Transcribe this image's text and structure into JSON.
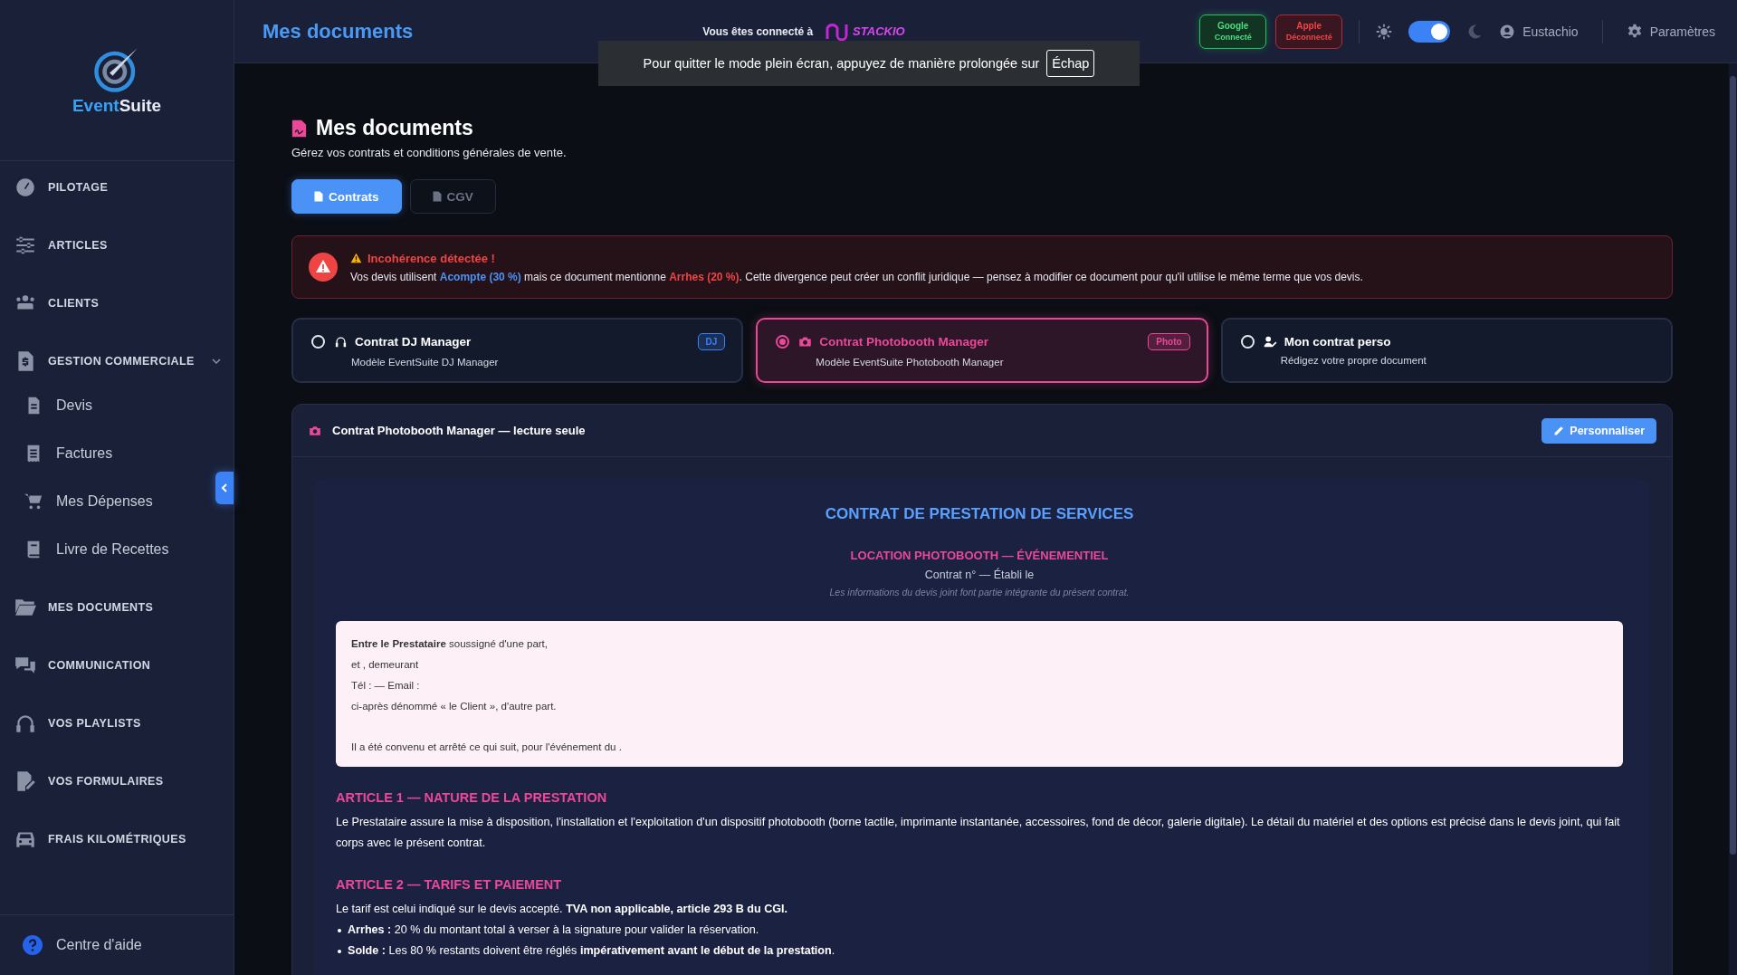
{
  "brand": {
    "first": "Event",
    "second": "Suite"
  },
  "sidebar": {
    "items": [
      {
        "label": "PILOTAGE"
      },
      {
        "label": "ARTICLES"
      },
      {
        "label": "CLIENTS"
      },
      {
        "label": "GESTION COMMERCIALE",
        "expanded": true,
        "children": [
          {
            "label": "Devis"
          },
          {
            "label": "Factures"
          },
          {
            "label": "Mes Dépenses"
          },
          {
            "label": "Livre de Recettes"
          }
        ]
      },
      {
        "label": "MES DOCUMENTS"
      },
      {
        "label": "COMMUNICATION"
      },
      {
        "label": "VOS PLAYLISTS"
      },
      {
        "label": "VOS FORMULAIRES"
      },
      {
        "label": "FRAIS KILOMÉTRIQUES"
      }
    ],
    "help": "Centre d'aide"
  },
  "header": {
    "title": "Mes documents",
    "connection_label": "Vous êtes connecté à",
    "partner_logo": "STACKIO",
    "services": [
      {
        "name": "Google",
        "status": "Connecté",
        "connected": true
      },
      {
        "name": "Apple",
        "status": "Déconnecté",
        "connected": false
      }
    ],
    "theme_toggle": {
      "on": true
    },
    "user": "Eustachio",
    "settings": "Paramètres"
  },
  "fullscreen_notice": {
    "text": "Pour quitter le mode plein écran, appuyez de manière prolongée sur",
    "key": "Échap"
  },
  "page": {
    "title": "Mes documents",
    "subtitle": "Gérez vos contrats et conditions générales de vente.",
    "tabs": [
      {
        "label": "Contrats",
        "selected": true
      },
      {
        "label": "CGV",
        "selected": false
      }
    ]
  },
  "alert": {
    "title": "Incohérence détectée !",
    "message": [
      {
        "text": "Vos devis utilisent ",
        "kind": "plain"
      },
      {
        "text": "Acompte (30 %)",
        "kind": "quote"
      },
      {
        "text": " mais ce document mentionne ",
        "kind": "plain"
      },
      {
        "text": "Arrhes (20 %)",
        "kind": "document"
      },
      {
        "text": ". Cette divergence peut créer un conflit juridique — pensez à modifier ce document pour qu'il utilise le même terme que vos devis.",
        "kind": "plain"
      }
    ]
  },
  "templates": [
    {
      "title": "Contrat DJ Manager",
      "subtitle": "Modèle EventSuite DJ Manager",
      "badge": "DJ",
      "color": "#3b82f6",
      "selected": false
    },
    {
      "title": "Contrat Photobooth Manager",
      "subtitle": "Modèle EventSuite Photobooth Manager",
      "badge": "Photo",
      "color": "#ec4899",
      "selected": true
    },
    {
      "title": "Mon contrat perso",
      "subtitle": "Rédigez votre propre document",
      "selected": false
    }
  ],
  "viewer": {
    "title": "Contrat Photobooth Manager — lecture seule",
    "button": "Personnaliser"
  },
  "document": {
    "title": "CONTRAT DE PRESTATION DE SERVICES",
    "subtitle": "LOCATION PHOTOBOOTH — ÉVÉNEMENTIEL",
    "meta": "Contrat n° — Établi le",
    "note": "Les informations du devis joint font partie intégrante du présent contrat.",
    "parties": [
      "**Entre le Prestataire** soussigné d'une part,",
      "et , demeurant",
      "Tél : — Email :",
      "ci-après dénommé « le Client », d'autre part."
    ],
    "agreement": "Il a été convenu et arrêté ce qui suit, pour l'événement du .",
    "articles": [
      {
        "heading": "ARTICLE 1 — NATURE DE LA PRESTATION",
        "paragraphs": [
          "Le Prestataire assure la mise à disposition, l'installation et l'exploitation d'un dispositif photobooth (borne tactile, imprimante instantanée, accessoires, fond de décor, galerie digitale). Le détail du matériel et des options est précisé dans le devis joint, qui fait corps avec le présent contrat."
        ]
      },
      {
        "heading": "ARTICLE 2 — TARIFS ET PAIEMENT",
        "paragraphs": [
          "Le tarif est celui indiqué sur le devis accepté. **TVA non applicable, article 293 B du CGI.**"
        ],
        "bullets": [
          "**Arrhes :** 20 % du montant total à verser à la signature pour valider la réservation.",
          "**Solde :** Les 80 % restants doivent être réglés **impérativement avant le début de la prestation**."
        ]
      }
    ]
  }
}
